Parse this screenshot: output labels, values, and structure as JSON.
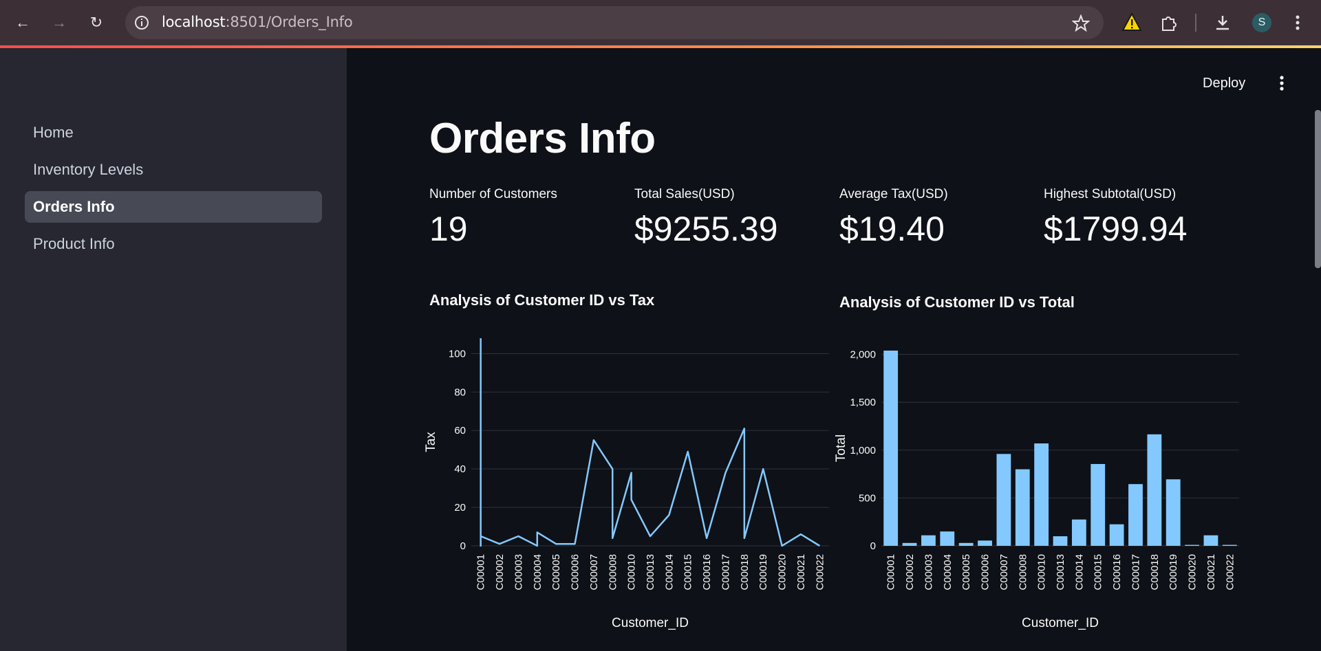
{
  "browser": {
    "back_icon": "←",
    "forward_icon": "→",
    "reload_icon": "↻",
    "url_host": "localhost",
    "url_rest": ":8501/Orders_Info",
    "profile_initial": "S"
  },
  "sidebar": {
    "items": [
      {
        "label": "Home"
      },
      {
        "label": "Inventory Levels"
      },
      {
        "label": "Orders Info"
      },
      {
        "label": "Product Info"
      }
    ],
    "active_index": 2
  },
  "header": {
    "deploy_label": "Deploy"
  },
  "page": {
    "title": "Orders Info"
  },
  "metrics": [
    {
      "label": "Number of Customers",
      "value": "19"
    },
    {
      "label": "Total Sales(USD)",
      "value": "$9255.39"
    },
    {
      "label": "Average Tax(USD)",
      "value": "$19.40"
    },
    {
      "label": "Highest Subtotal(USD)",
      "value": "$1799.94"
    }
  ],
  "colors": {
    "accent": "#83c9ff",
    "sidebar_bg": "#262730",
    "main_bg": "#0e1117"
  },
  "chart_data": [
    {
      "type": "line",
      "title": "Analysis of Customer ID vs Tax",
      "xlabel": "Customer_ID",
      "ylabel": "Tax",
      "categories": [
        "C00001",
        "C00002",
        "C00003",
        "C00004",
        "C00005",
        "C00006",
        "C00007",
        "C00008",
        "C00010",
        "C00013",
        "C00014",
        "C00015",
        "C00016",
        "C00017",
        "C00018",
        "C00019",
        "C00020",
        "C00021",
        "C00022"
      ],
      "y_ticks": [
        0,
        20,
        40,
        60,
        80,
        100
      ],
      "ylim": [
        0,
        108
      ],
      "grid": true,
      "points": [
        {
          "x": "C00001",
          "y": 108
        },
        {
          "x": "C00001",
          "y": 0
        },
        {
          "x": "C00001",
          "y": 5
        },
        {
          "x": "C00002",
          "y": 1
        },
        {
          "x": "C00003",
          "y": 5
        },
        {
          "x": "C00004",
          "y": 0
        },
        {
          "x": "C00004",
          "y": 7
        },
        {
          "x": "C00005",
          "y": 1
        },
        {
          "x": "C00006",
          "y": 1
        },
        {
          "x": "C00007",
          "y": 55
        },
        {
          "x": "C00008",
          "y": 40
        },
        {
          "x": "C00008",
          "y": 4
        },
        {
          "x": "C00010",
          "y": 38
        },
        {
          "x": "C00010",
          "y": 24
        },
        {
          "x": "C00013",
          "y": 5
        },
        {
          "x": "C00014",
          "y": 16
        },
        {
          "x": "C00015",
          "y": 49
        },
        {
          "x": "C00016",
          "y": 4
        },
        {
          "x": "C00017",
          "y": 38
        },
        {
          "x": "C00018",
          "y": 61
        },
        {
          "x": "C00018",
          "y": 4
        },
        {
          "x": "C00019",
          "y": 40
        },
        {
          "x": "C00020",
          "y": 0
        },
        {
          "x": "C00021",
          "y": 6
        },
        {
          "x": "C00022",
          "y": 0
        }
      ]
    },
    {
      "type": "bar",
      "title": "Analysis of Customer ID vs Total",
      "xlabel": "Customer_ID",
      "ylabel": "Total",
      "categories": [
        "C00001",
        "C00002",
        "C00003",
        "C00004",
        "C00005",
        "C00006",
        "C00007",
        "C00008",
        "C00010",
        "C00013",
        "C00014",
        "C00015",
        "C00016",
        "C00017",
        "C00018",
        "C00019",
        "C00020",
        "C00021",
        "C00022"
      ],
      "values": [
        2040,
        30,
        110,
        150,
        30,
        55,
        960,
        800,
        1070,
        100,
        275,
        855,
        225,
        645,
        1165,
        695,
        10,
        110,
        10
      ],
      "y_ticks": [
        0,
        500,
        1000,
        1500,
        2000
      ],
      "y_tick_labels": [
        "0",
        "500",
        "1,000",
        "1,500",
        "2,000"
      ],
      "ylim": [
        0,
        2040
      ],
      "grid": true
    }
  ]
}
